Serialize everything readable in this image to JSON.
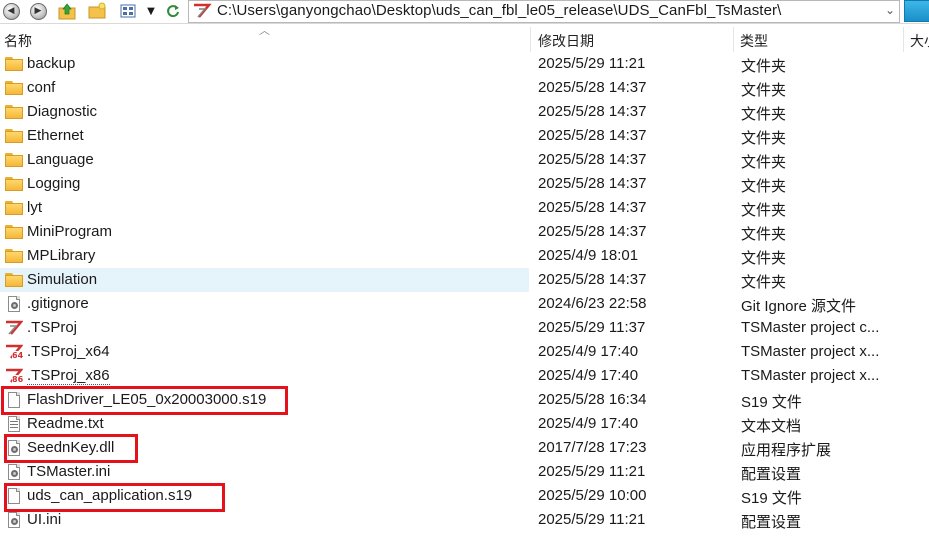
{
  "address_bar": {
    "path": "C:\\Users\\ganyongchao\\Desktop\\uds_can_fbl_le05_release\\UDS_CanFbl_TsMaster\\"
  },
  "toolbar_icons": [
    "back-icon",
    "forward-icon",
    "up-folder-icon",
    "new-folder-icon",
    "view-mode-icon",
    "dropdown-icon",
    "refresh-icon"
  ],
  "columns": {
    "name": "名称",
    "date": "修改日期",
    "type": "类型",
    "size": "大小"
  },
  "files": [
    {
      "name": "backup",
      "date": "2025/5/29 11:21",
      "type": "文件夹",
      "icon": "folder-icon"
    },
    {
      "name": "conf",
      "date": "2025/5/28 14:37",
      "type": "文件夹",
      "icon": "folder-icon"
    },
    {
      "name": "Diagnostic",
      "date": "2025/5/28 14:37",
      "type": "文件夹",
      "icon": "folder-icon"
    },
    {
      "name": "Ethernet",
      "date": "2025/5/28 14:37",
      "type": "文件夹",
      "icon": "folder-icon"
    },
    {
      "name": "Language",
      "date": "2025/5/28 14:37",
      "type": "文件夹",
      "icon": "folder-icon"
    },
    {
      "name": "Logging",
      "date": "2025/5/28 14:37",
      "type": "文件夹",
      "icon": "folder-icon"
    },
    {
      "name": "lyt",
      "date": "2025/5/28 14:37",
      "type": "文件夹",
      "icon": "folder-icon"
    },
    {
      "name": "MiniProgram",
      "date": "2025/5/28 14:37",
      "type": "文件夹",
      "icon": "folder-icon"
    },
    {
      "name": "MPLibrary",
      "date": "2025/4/9 18:01",
      "type": "文件夹",
      "icon": "folder-icon"
    },
    {
      "name": "Simulation",
      "date": "2025/5/28 14:37",
      "type": "文件夹",
      "icon": "folder-icon"
    },
    {
      "name": ".gitignore",
      "date": "2024/6/23 22:58",
      "type": "Git Ignore 源文件",
      "icon": "gear-file-icon"
    },
    {
      "name": ".TSProj",
      "date": "2025/5/29 11:37",
      "type": "TSMaster project c...",
      "icon": "tsmaster-icon"
    },
    {
      "name": ".TSProj_x64",
      "date": "2025/4/9 17:40",
      "type": "TSMaster project x...",
      "icon": "tsmaster-x64-icon"
    },
    {
      "name": ".TSProj_x86",
      "date": "2025/4/9 17:40",
      "type": "TSMaster project x...",
      "icon": "tsmaster-x86-icon"
    },
    {
      "name": "FlashDriver_LE05_0x20003000.s19",
      "date": "2025/5/28 16:34",
      "type": "S19 文件",
      "icon": "document-icon"
    },
    {
      "name": "Readme.txt",
      "date": "2025/4/9 17:40",
      "type": "文本文档",
      "icon": "text-file-icon"
    },
    {
      "name": "SeednKey.dll",
      "date": "2017/7/28 17:23",
      "type": "应用程序扩展",
      "icon": "dll-file-icon"
    },
    {
      "name": "TSMaster.ini",
      "date": "2025/5/29 11:21",
      "type": "配置设置",
      "icon": "ini-file-icon"
    },
    {
      "name": "uds_can_application.s19",
      "date": "2025/5/29 10:00",
      "type": "S19 文件",
      "icon": "document-icon"
    },
    {
      "name": "UI.ini",
      "date": "2025/5/29 11:21",
      "type": "配置设置",
      "icon": "ini-file-icon"
    }
  ],
  "colors": {
    "highlight_box": "#e5121b",
    "selected_row": "#e5f3fb",
    "folder": "#f4b73a"
  }
}
